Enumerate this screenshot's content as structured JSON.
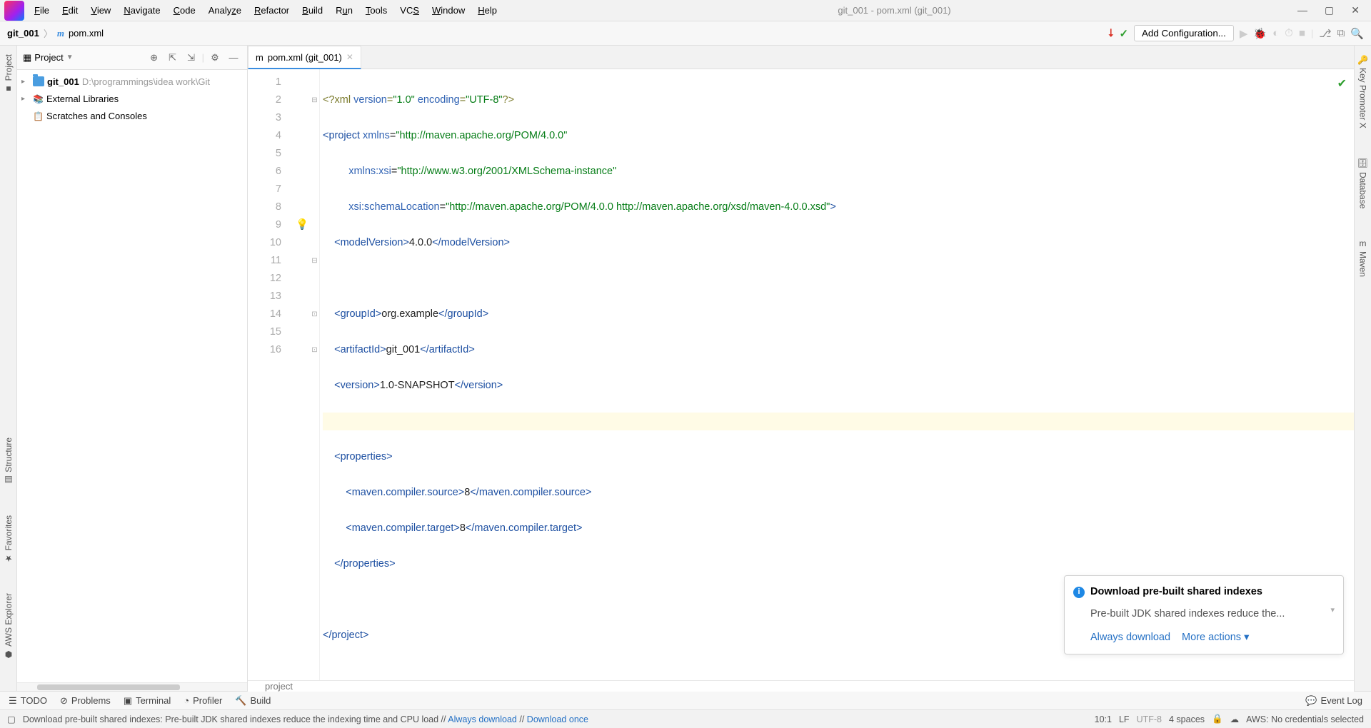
{
  "window": {
    "title": "git_001 - pom.xml (git_001)"
  },
  "menu": [
    "File",
    "Edit",
    "View",
    "Navigate",
    "Code",
    "Analyze",
    "Refactor",
    "Build",
    "Run",
    "Tools",
    "VCS",
    "Window",
    "Help"
  ],
  "navbar": {
    "crumb1": "git_001",
    "crumb2": "pom.xml",
    "add_config": "Add Configuration..."
  },
  "left_tabs": [
    "Project",
    "Structure",
    "Favorites",
    "AWS Explorer"
  ],
  "right_tabs": [
    "Key Promoter X",
    "Database",
    "Maven"
  ],
  "project_panel": {
    "title": "Project",
    "root_name": "git_001",
    "root_path": "D:\\programmings\\idea work\\Git",
    "external_libs": "External Libraries",
    "scratches": "Scratches and Consoles"
  },
  "tab": {
    "label": "pom.xml (git_001)"
  },
  "code": {
    "l1": "<?xml version=\"1.0\" encoding=\"UTF-8\"?>",
    "l2a": "<project ",
    "l2b": "xmlns",
    "l2c": "=\"http://maven.apache.org/POM/4.0.0\"",
    "l3a": "         xmlns:xsi",
    "l3b": "=\"http://www.w3.org/2001/XMLSchema-instance\"",
    "l4a": "         xsi:schemaLocation",
    "l4b": "=\"http://maven.apache.org/POM/4.0.0 http://maven.apache.org/xsd/maven-4.0.0.xsd\"",
    "l4c": ">",
    "l5": "    <modelVersion>4.0.0</modelVersion>",
    "l7": "    <groupId>org.example</groupId>",
    "l8": "    <artifactId>git_001</artifactId>",
    "l9": "    <version>1.0-SNAPSHOT</version>",
    "l11": "    <properties>",
    "l12": "        <maven.compiler.source>8</maven.compiler.source>",
    "l13": "        <maven.compiler.target>8</maven.compiler.target>",
    "l14": "    </properties>",
    "l16": "</project>"
  },
  "line_numbers": [
    "1",
    "2",
    "3",
    "4",
    "5",
    "6",
    "7",
    "8",
    "9",
    "10",
    "11",
    "12",
    "13",
    "14",
    "15",
    "16"
  ],
  "breadcrumb": "project",
  "notification": {
    "title": "Download pre-built shared indexes",
    "body": "Pre-built JDK shared indexes reduce the...",
    "action1": "Always download",
    "action2": "More actions"
  },
  "bottom_tools": [
    "TODO",
    "Problems",
    "Terminal",
    "Profiler",
    "Build"
  ],
  "event_log": "Event Log",
  "status": {
    "msg_prefix": "Download pre-built shared indexes: Pre-built JDK shared indexes reduce the indexing time and CPU load // ",
    "link1": "Always download",
    "sep": " // ",
    "link2": "Download once",
    "pos": "10:1",
    "le": "LF",
    "enc": "UTF-8",
    "indent": "4 spaces",
    "aws": "AWS: No credentials selected"
  }
}
